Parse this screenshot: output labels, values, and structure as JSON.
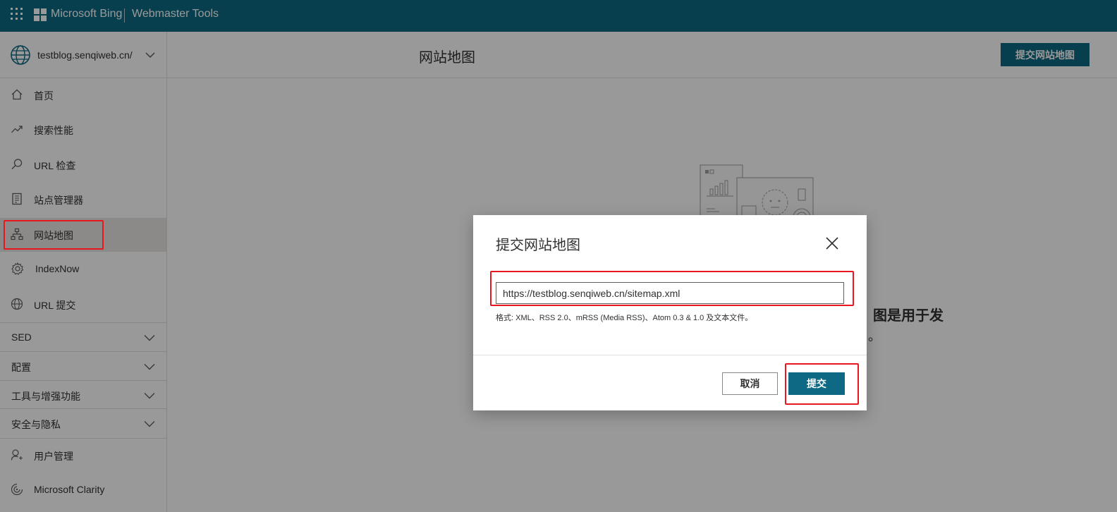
{
  "topbar": {
    "brand": "Microsoft Bing",
    "product": "Webmaster Tools",
    "bg_color": "#0e6a84"
  },
  "sidebar": {
    "site": "testblog.senqiweb.cn/",
    "items": [
      {
        "label": "首页",
        "icon": "home-icon"
      },
      {
        "label": "搜索性能",
        "icon": "trend-icon"
      },
      {
        "label": "URL 检查",
        "icon": "search-icon"
      },
      {
        "label": "站点管理器",
        "icon": "document-icon"
      },
      {
        "label": "网站地图",
        "icon": "sitemap-icon",
        "active": true
      },
      {
        "label": "IndexNow",
        "icon": "gear-icon"
      },
      {
        "label": "URL 提交",
        "icon": "globe-icon"
      }
    ],
    "groups": [
      {
        "label": "SED"
      },
      {
        "label": "配置"
      },
      {
        "label": "工具与增强功能"
      },
      {
        "label": "安全与隐私"
      }
    ],
    "bottom_items": [
      {
        "label": "用户管理",
        "icon": "user-icon"
      },
      {
        "label": "Microsoft Clarity",
        "icon": "clarity-icon"
      }
    ]
  },
  "main": {
    "title": "网站地图",
    "header_button": "提交网站地图",
    "bg_text_line1": "图是用于发",
    "bg_text_line2": "。"
  },
  "dialog": {
    "title": "提交网站地图",
    "input_value": "https://testblog.senqiweb.cn/sitemap.xml",
    "hint": "格式: XML、RSS 2.0、mRSS (Media RSS)、Atom 0.3 & 1.0 及文本文件。",
    "cancel_label": "取消",
    "submit_label": "提交"
  },
  "colors": {
    "accent": "#0e6a84",
    "highlight": "#e8161e"
  }
}
